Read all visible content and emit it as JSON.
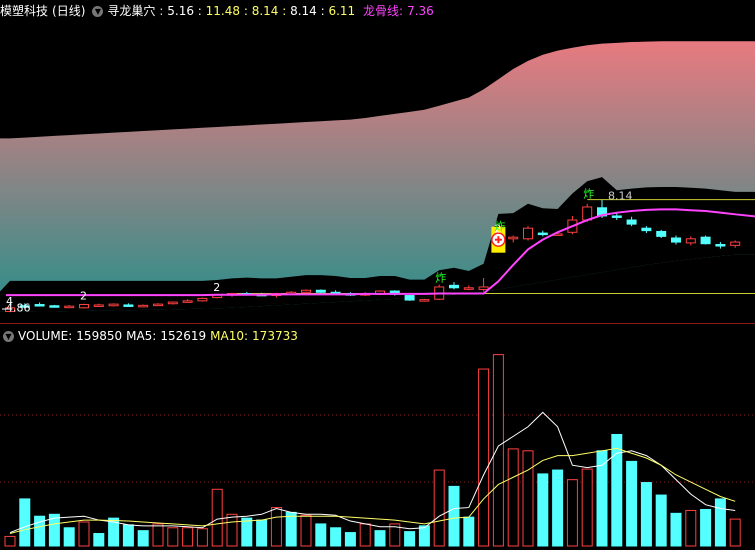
{
  "header": {
    "stock_name": "模塑科技",
    "period": "(日线)",
    "indicator_name": "寻龙巢穴",
    "values": [
      {
        "text": "5.16",
        "color": "#ffffff"
      },
      {
        "text": "11.48",
        "color": "#ffff66"
      },
      {
        "text": "8.14",
        "color": "#ffff66"
      },
      {
        "text": "8.14",
        "color": "#ffffff"
      },
      {
        "text": "6.11",
        "color": "#ffff66"
      }
    ],
    "dragon_label": "龙骨线:",
    "dragon_value": "7.36",
    "dragon_color": "#ff44ff"
  },
  "vol_header": {
    "volume_label": "VOLUME:",
    "volume_value": "159850",
    "ma5_label": "MA5:",
    "ma5_value": "152619",
    "ma10_label": "MA10:",
    "ma10_value": "173733"
  },
  "colors": {
    "up": "#ff4040",
    "down": "#54ffff",
    "dragon": "#ff44ff",
    "ma5": "#ffffff",
    "ma10": "#ffff66",
    "grid": "#8a1c1c",
    "band_top": "#e87a80",
    "band_bottom": "#2a8f8a"
  },
  "chart_data": {
    "type": "candlestick",
    "x": [
      1,
      2,
      3,
      4,
      5,
      6,
      7,
      8,
      9,
      10,
      11,
      12,
      13,
      14,
      15,
      16,
      17,
      18,
      19,
      20,
      21,
      22,
      23,
      24,
      25,
      26,
      27,
      28,
      29,
      30,
      31,
      32,
      33,
      34,
      35,
      36,
      37,
      38,
      39,
      40,
      41,
      42,
      43,
      44,
      45,
      46,
      47,
      48,
      49,
      50
    ],
    "ohlc": [
      [
        4.86,
        4.98,
        4.84,
        4.95
      ],
      [
        5.0,
        5.06,
        4.95,
        4.98
      ],
      [
        5.03,
        5.08,
        4.98,
        5.0
      ],
      [
        5.0,
        5.02,
        4.96,
        4.98
      ],
      [
        4.98,
        5.02,
        4.95,
        4.99
      ],
      [
        4.95,
        5.05,
        4.93,
        5.03
      ],
      [
        5.01,
        5.05,
        4.98,
        5.02
      ],
      [
        5.0,
        5.06,
        4.98,
        5.04
      ],
      [
        5.02,
        5.06,
        4.99,
        5.0
      ],
      [
        5.0,
        5.03,
        4.98,
        5.01
      ],
      [
        5.02,
        5.06,
        5.0,
        5.04
      ],
      [
        5.05,
        5.1,
        5.03,
        5.09
      ],
      [
        5.1,
        5.16,
        5.08,
        5.12
      ],
      [
        5.12,
        5.2,
        5.1,
        5.18
      ],
      [
        5.2,
        5.28,
        5.18,
        5.26
      ],
      [
        5.26,
        5.32,
        5.22,
        5.3
      ],
      [
        5.3,
        5.34,
        5.25,
        5.28
      ],
      [
        5.28,
        5.32,
        5.24,
        5.27
      ],
      [
        5.25,
        5.32,
        5.2,
        5.3
      ],
      [
        5.32,
        5.36,
        5.28,
        5.33
      ],
      [
        5.33,
        5.4,
        5.3,
        5.38
      ],
      [
        5.38,
        5.4,
        5.31,
        5.33
      ],
      [
        5.33,
        5.38,
        5.28,
        5.31
      ],
      [
        5.3,
        5.33,
        5.24,
        5.26
      ],
      [
        5.26,
        5.33,
        5.24,
        5.3
      ],
      [
        5.28,
        5.38,
        5.26,
        5.36
      ],
      [
        5.36,
        5.38,
        5.25,
        5.28
      ],
      [
        5.25,
        5.26,
        5.12,
        5.14
      ],
      [
        5.14,
        5.17,
        5.1,
        5.15
      ],
      [
        5.16,
        5.52,
        5.14,
        5.46
      ],
      [
        5.5,
        5.58,
        5.4,
        5.44
      ],
      [
        5.42,
        5.5,
        5.38,
        5.44
      ],
      [
        5.4,
        5.68,
        5.35,
        5.46
      ],
      [
        6.42,
        6.7,
        6.3,
        6.66
      ],
      [
        6.64,
        6.72,
        6.55,
        6.68
      ],
      [
        6.64,
        6.95,
        6.6,
        6.9
      ],
      [
        6.78,
        6.84,
        6.7,
        6.76
      ],
      [
        6.76,
        6.82,
        6.72,
        6.76
      ],
      [
        6.8,
        7.2,
        6.75,
        7.1
      ],
      [
        7.1,
        7.5,
        7.05,
        7.42
      ],
      [
        7.4,
        7.6,
        7.15,
        7.2
      ],
      [
        7.2,
        7.28,
        7.1,
        7.18
      ],
      [
        7.1,
        7.18,
        6.95,
        7.0
      ],
      [
        6.9,
        6.95,
        6.78,
        6.84
      ],
      [
        6.82,
        6.86,
        6.66,
        6.7
      ],
      [
        6.66,
        6.72,
        6.5,
        6.56
      ],
      [
        6.54,
        6.7,
        6.48,
        6.64
      ],
      [
        6.68,
        6.72,
        6.5,
        6.52
      ],
      [
        6.5,
        6.56,
        6.4,
        6.48
      ],
      [
        6.48,
        6.6,
        6.42,
        6.56
      ]
    ],
    "dragon_line": [
      5.26,
      5.26,
      5.26,
      5.26,
      5.26,
      5.26,
      5.26,
      5.26,
      5.26,
      5.26,
      5.26,
      5.26,
      5.26,
      5.26,
      5.27,
      5.27,
      5.27,
      5.27,
      5.28,
      5.28,
      5.28,
      5.28,
      5.28,
      5.28,
      5.29,
      5.29,
      5.29,
      5.29,
      5.29,
      5.3,
      5.3,
      5.3,
      5.3,
      5.6,
      6.0,
      6.38,
      6.62,
      6.8,
      6.95,
      7.1,
      7.22,
      7.28,
      7.32,
      7.35,
      7.36,
      7.36,
      7.34,
      7.32,
      7.28,
      7.24
    ],
    "band_upper": [
      9.1,
      9.12,
      9.14,
      9.16,
      9.18,
      9.2,
      9.22,
      9.24,
      9.26,
      9.28,
      9.3,
      9.32,
      9.34,
      9.36,
      9.38,
      9.4,
      9.42,
      9.44,
      9.46,
      9.48,
      9.5,
      9.52,
      9.54,
      9.56,
      9.6,
      9.65,
      9.7,
      9.75,
      9.8,
      9.9,
      10.0,
      10.1,
      10.3,
      10.55,
      10.8,
      11.0,
      11.15,
      11.25,
      11.32,
      11.38,
      11.42,
      11.44,
      11.46,
      11.47,
      11.48,
      11.48,
      11.48,
      11.48,
      11.48,
      11.48
    ],
    "band_lower": [
      4.85,
      4.85,
      4.86,
      4.86,
      4.87,
      4.87,
      4.88,
      4.88,
      4.89,
      4.9,
      4.9,
      4.91,
      4.92,
      4.93,
      4.94,
      4.95,
      4.97,
      4.99,
      5.01,
      5.03,
      5.05,
      5.07,
      5.09,
      5.11,
      5.13,
      5.15,
      5.17,
      5.19,
      5.21,
      5.24,
      5.27,
      5.3,
      5.34,
      5.4,
      5.46,
      5.52,
      5.58,
      5.64,
      5.7,
      5.76,
      5.82,
      5.88,
      5.94,
      6.0,
      6.05,
      6.1,
      6.14,
      6.18,
      6.22,
      6.25
    ],
    "hlines": [
      {
        "value": 7.6,
        "x_start": 40,
        "color": "#cccc33"
      },
      {
        "value": 5.3,
        "x_start": 16,
        "color": "#cccc33"
      }
    ],
    "labels": [
      {
        "x": 1,
        "value": 4.86,
        "text": "4.86",
        "color": "#ffffff"
      },
      {
        "x": 1,
        "value": 5.02,
        "text": "4",
        "color": "#ffffff"
      },
      {
        "x": 6,
        "value": 5.15,
        "text": "2",
        "color": "#ffffff"
      },
      {
        "x": 15,
        "value": 5.36,
        "text": "2",
        "color": "#ffffff"
      },
      {
        "x": 30,
        "value": 5.6,
        "text": "炸",
        "color": "#22ff22"
      },
      {
        "x": 34,
        "value": 6.8,
        "text": "2",
        "color": "#ffffff"
      },
      {
        "x": 34,
        "value": 6.85,
        "text": "炸",
        "color": "#22ff22"
      },
      {
        "x": 40,
        "value": 7.65,
        "text": "炸",
        "color": "#22ff22"
      },
      {
        "x": 41,
        "value": 7.6,
        "text": "8.14",
        "color": "#cccccc"
      }
    ],
    "signal_x": 33,
    "ylim": [
      4.7,
      12.0
    ],
    "volume": [
      22000,
      100000,
      64000,
      68000,
      40000,
      52000,
      28000,
      60000,
      46000,
      34000,
      48000,
      40000,
      40000,
      38000,
      120000,
      68000,
      60000,
      56000,
      82000,
      72000,
      66000,
      48000,
      40000,
      30000,
      48000,
      34000,
      48000,
      32000,
      44000,
      160000,
      126000,
      62000,
      370000,
      400000,
      204000,
      200000,
      152000,
      160000,
      140000,
      162000,
      200000,
      234000,
      178000,
      134000,
      108000,
      70000,
      76000,
      78000,
      100000,
      58000
    ],
    "volume_up": [
      true,
      false,
      false,
      false,
      false,
      true,
      false,
      false,
      false,
      false,
      true,
      true,
      true,
      true,
      true,
      true,
      false,
      false,
      true,
      false,
      true,
      false,
      false,
      false,
      true,
      false,
      true,
      false,
      false,
      true,
      false,
      false,
      true,
      true,
      true,
      true,
      false,
      false,
      true,
      true,
      false,
      false,
      false,
      false,
      false,
      false,
      true,
      false,
      false,
      true
    ],
    "ma5": [
      30000,
      42000,
      52000,
      60000,
      62000,
      64000,
      56000,
      52000,
      46000,
      44000,
      44000,
      44000,
      42000,
      40000,
      58000,
      62000,
      64000,
      68000,
      80000,
      72000,
      68000,
      68000,
      66000,
      54000,
      48000,
      42000,
      42000,
      38000,
      40000,
      64000,
      80000,
      82000,
      150000,
      210000,
      230000,
      250000,
      280000,
      250000,
      170000,
      165000,
      170000,
      195000,
      200000,
      190000,
      170000,
      140000,
      110000,
      88000,
      80000,
      76000
    ],
    "ma10": [
      28000,
      36000,
      42000,
      48000,
      52000,
      56000,
      56000,
      55000,
      54000,
      52000,
      50000,
      48000,
      46000,
      44000,
      48000,
      52000,
      54000,
      56000,
      62000,
      64000,
      64000,
      64000,
      64000,
      62000,
      60000,
      58000,
      56000,
      52000,
      48000,
      54000,
      60000,
      62000,
      100000,
      130000,
      145000,
      160000,
      180000,
      190000,
      190000,
      195000,
      200000,
      205000,
      195000,
      185000,
      170000,
      150000,
      135000,
      120000,
      105000,
      95000
    ],
    "vol_ylim": [
      0,
      420000
    ]
  }
}
